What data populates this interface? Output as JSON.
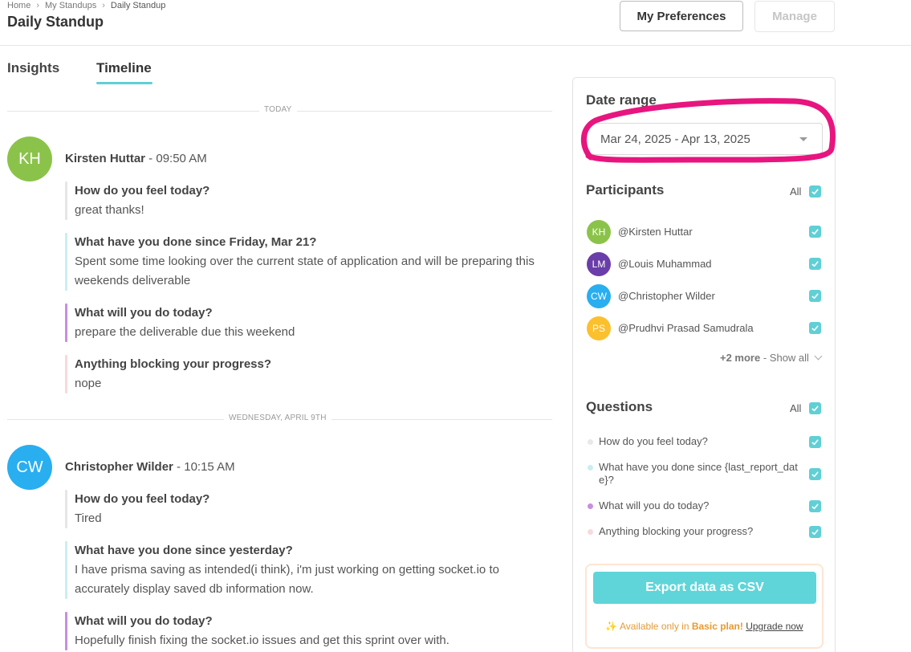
{
  "breadcrumb": {
    "home": "Home",
    "standups": "My Standups",
    "current": "Daily Standup"
  },
  "page_title": "Daily Standup",
  "header": {
    "preferences_label": "My Preferences",
    "manage_label": "Manage"
  },
  "tabs": [
    {
      "label": "Insights"
    },
    {
      "label": "Timeline"
    }
  ],
  "timeline": {
    "days": [
      {
        "label": "TODAY",
        "entry": {
          "initials": "KH",
          "avatar_color": "#8bc34a",
          "name": "Kirsten Huttar",
          "time": " - 09:50 AM",
          "qa": [
            {
              "q": "How do you feel today?",
              "a": "great thanks!",
              "color": "#e6e6e6"
            },
            {
              "q": "What have you done since Friday, Mar 21?",
              "a": "Spent some time looking over the current state of application and will be preparing this weekends deliverable",
              "color": "#c9eef1"
            },
            {
              "q": "What will you do today?",
              "a": "prepare the deliverable due this weekend",
              "color": "#c98ee0"
            },
            {
              "q": "Anything blocking your progress?",
              "a": "nope",
              "color": "#f8d9dd"
            }
          ]
        }
      },
      {
        "label": "WEDNESDAY, APRIL 9TH",
        "entry": {
          "initials": "CW",
          "avatar_color": "#29aef0",
          "name": "Christopher Wilder",
          "time": " - 10:15 AM",
          "qa": [
            {
              "q": "How do you feel today?",
              "a": "Tired",
              "color": "#e6e6e6"
            },
            {
              "q": "What have you done since yesterday?",
              "a": "I have prisma saving as intended(i think), i'm just working on getting socket.io to accurately display saved db information now.",
              "color": "#c9eef1"
            },
            {
              "q": "What will you do today?",
              "a": "Hopefully finish fixing the socket.io issues and get this sprint over with.",
              "color": "#c98ee0"
            }
          ]
        }
      }
    ]
  },
  "sidebar": {
    "date_range": {
      "title": "Date range",
      "value": "Mar 24, 2025 - Apr 13, 2025"
    },
    "participants": {
      "title": "Participants",
      "all_label": "All",
      "items": [
        {
          "initials": "KH",
          "name": "@Kirsten Huttar",
          "color": "#8bc34a",
          "checked": true
        },
        {
          "initials": "LM",
          "name": "@Louis Muhammad",
          "color": "#6a3ea8",
          "checked": true
        },
        {
          "initials": "CW",
          "name": "@Christopher Wilder",
          "color": "#29aef0",
          "checked": true
        },
        {
          "initials": "PS",
          "name": "@Prudhvi Prasad Samudrala",
          "color": "#fbc02d",
          "checked": true
        }
      ],
      "more_count": "+2 more",
      "show_all": "Show all"
    },
    "questions": {
      "title": "Questions",
      "all_label": "All",
      "items": [
        {
          "text": "How do you feel today?",
          "dot": "#e8e8e8",
          "checked": true
        },
        {
          "text": "What have you done since {last_report_date}?",
          "dot": "#c9eef1",
          "checked": true
        },
        {
          "text": "What will you do today?",
          "dot": "#c98ee0",
          "checked": true
        },
        {
          "text": "Anything blocking your progress?",
          "dot": "#f8d9dd",
          "checked": true
        }
      ]
    },
    "export": {
      "button_label": "Export data as CSV",
      "note_prefix": "✨ Available only in ",
      "plan_name": "Basic plan!",
      "upgrade_label": "Upgrade now"
    }
  },
  "colors": {
    "accent": "#5fd0d5",
    "annotation": "#e8157f"
  }
}
